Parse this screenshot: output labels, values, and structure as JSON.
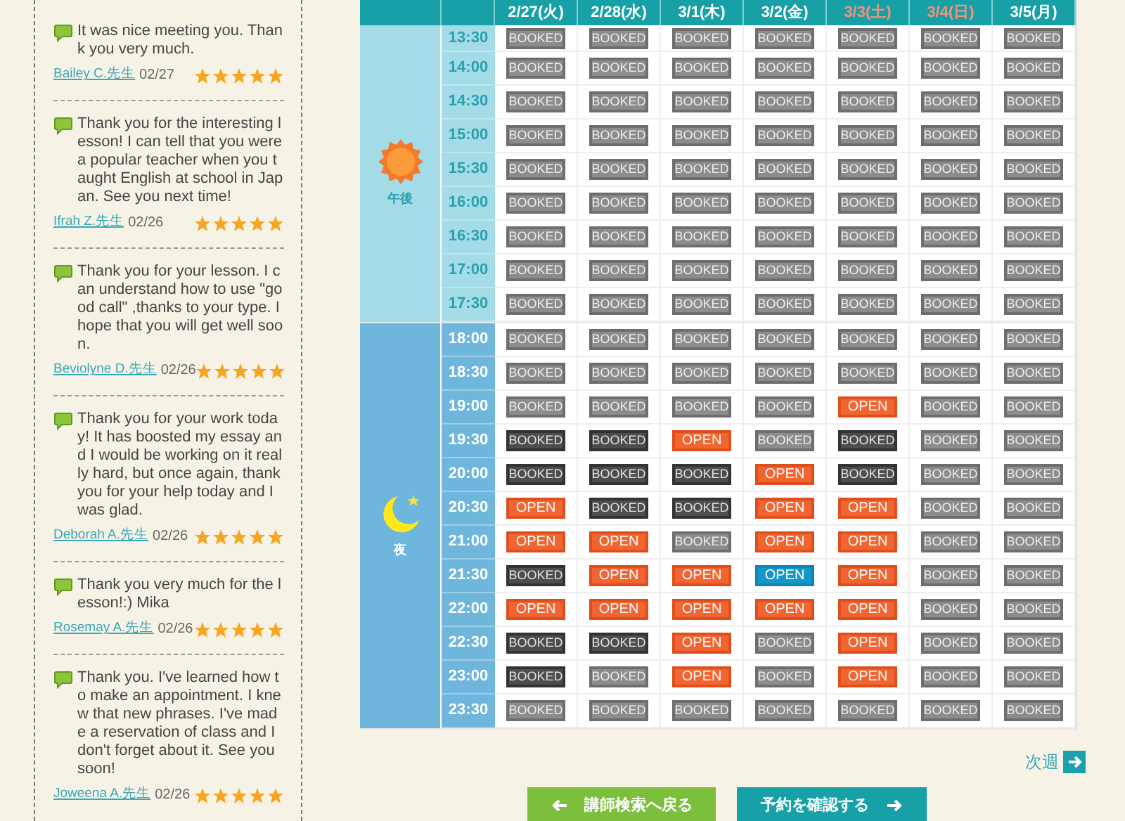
{
  "reviews": [
    {
      "text": "It was nice meeting you. Thank you very much.",
      "teacher": "Bailey C.先生",
      "date": "02/27",
      "stars": 5
    },
    {
      "text": "Thank you for the interesting lesson! I can tell that you were a popular teacher when you taught English at school in Japan. See you next time!",
      "teacher": "Ifrah Z.先生",
      "date": "02/26",
      "stars": 5
    },
    {
      "text": "Thank you for your lesson. I can understand how to use \"good call\" ,thanks to your type. I hope that you will get well soon.",
      "teacher": "Beviolyne D.先生",
      "date": "02/26",
      "stars": 5
    },
    {
      "text": "Thank you for your work today! It has boosted my essay and I would be working on it really hard, but once again, thank you for your help today and I was glad.",
      "teacher": "Deborah A.先生",
      "date": "02/26",
      "stars": 5
    },
    {
      "text": "Thank you very much for the lesson!:) Mika",
      "teacher": "Rosemay A.先生",
      "date": "02/26",
      "stars": 5
    },
    {
      "text": "Thank you. I've learned how to make an appointment. I knew that new phrases. I've made a reservation of class and I don't forget about it. See you soon!",
      "teacher": "Joweena A.先生",
      "date": "02/26",
      "stars": 5
    }
  ],
  "schedule": {
    "days": [
      {
        "label": "2/27(火)",
        "weekend": false
      },
      {
        "label": "2/28(水)",
        "weekend": false
      },
      {
        "label": "3/1(木)",
        "weekend": false
      },
      {
        "label": "3/2(金)",
        "weekend": false
      },
      {
        "label": "3/3(土)",
        "weekend": true
      },
      {
        "label": "3/4(日)",
        "weekend": true
      },
      {
        "label": "3/5(月)",
        "weekend": false
      }
    ],
    "periods": [
      {
        "kind": "afternoon",
        "label": "午後",
        "rows": [
          {
            "time": "13:30",
            "slots": [
              {
                "kind": "closed",
                "label": "BOOKED"
              },
              {
                "kind": "closed",
                "label": "BOOKED"
              },
              {
                "kind": "closed",
                "label": "BOOKED"
              },
              {
                "kind": "closed",
                "label": "BOOKED"
              },
              {
                "kind": "closed",
                "label": "BOOKED"
              },
              {
                "kind": "closed",
                "label": "BOOKED"
              },
              {
                "kind": "closed",
                "label": "BOOKED"
              }
            ]
          },
          {
            "time": "14:00",
            "slots": [
              {
                "kind": "closed",
                "label": "BOOKED"
              },
              {
                "kind": "closed",
                "label": "BOOKED"
              },
              {
                "kind": "closed",
                "label": "BOOKED"
              },
              {
                "kind": "closed",
                "label": "BOOKED"
              },
              {
                "kind": "closed",
                "label": "BOOKED"
              },
              {
                "kind": "closed",
                "label": "BOOKED"
              },
              {
                "kind": "closed",
                "label": "BOOKED"
              }
            ]
          },
          {
            "time": "14:30",
            "slots": [
              {
                "kind": "closed",
                "label": "BOOKED"
              },
              {
                "kind": "closed",
                "label": "BOOKED"
              },
              {
                "kind": "closed",
                "label": "BOOKED"
              },
              {
                "kind": "closed",
                "label": "BOOKED"
              },
              {
                "kind": "closed",
                "label": "BOOKED"
              },
              {
                "kind": "closed",
                "label": "BOOKED"
              },
              {
                "kind": "closed",
                "label": "BOOKED"
              }
            ]
          },
          {
            "time": "15:00",
            "slots": [
              {
                "kind": "closed",
                "label": "BOOKED"
              },
              {
                "kind": "closed",
                "label": "BOOKED"
              },
              {
                "kind": "closed",
                "label": "BOOKED"
              },
              {
                "kind": "closed",
                "label": "BOOKED"
              },
              {
                "kind": "closed",
                "label": "BOOKED"
              },
              {
                "kind": "closed",
                "label": "BOOKED"
              },
              {
                "kind": "closed",
                "label": "BOOKED"
              }
            ]
          },
          {
            "time": "15:30",
            "slots": [
              {
                "kind": "closed",
                "label": "BOOKED"
              },
              {
                "kind": "closed",
                "label": "BOOKED"
              },
              {
                "kind": "closed",
                "label": "BOOKED"
              },
              {
                "kind": "closed",
                "label": "BOOKED"
              },
              {
                "kind": "closed",
                "label": "BOOKED"
              },
              {
                "kind": "closed",
                "label": "BOOKED"
              },
              {
                "kind": "closed",
                "label": "BOOKED"
              }
            ]
          },
          {
            "time": "16:00",
            "slots": [
              {
                "kind": "closed",
                "label": "BOOKED"
              },
              {
                "kind": "closed",
                "label": "BOOKED"
              },
              {
                "kind": "closed",
                "label": "BOOKED"
              },
              {
                "kind": "closed",
                "label": "BOOKED"
              },
              {
                "kind": "closed",
                "label": "BOOKED"
              },
              {
                "kind": "closed",
                "label": "BOOKED"
              },
              {
                "kind": "closed",
                "label": "BOOKED"
              }
            ]
          },
          {
            "time": "16:30",
            "slots": [
              {
                "kind": "closed",
                "label": "BOOKED"
              },
              {
                "kind": "closed",
                "label": "BOOKED"
              },
              {
                "kind": "closed",
                "label": "BOOKED"
              },
              {
                "kind": "closed",
                "label": "BOOKED"
              },
              {
                "kind": "closed",
                "label": "BOOKED"
              },
              {
                "kind": "closed",
                "label": "BOOKED"
              },
              {
                "kind": "closed",
                "label": "BOOKED"
              }
            ]
          },
          {
            "time": "17:00",
            "slots": [
              {
                "kind": "closed",
                "label": "BOOKED"
              },
              {
                "kind": "closed",
                "label": "BOOKED"
              },
              {
                "kind": "closed",
                "label": "BOOKED"
              },
              {
                "kind": "closed",
                "label": "BOOKED"
              },
              {
                "kind": "closed",
                "label": "BOOKED"
              },
              {
                "kind": "closed",
                "label": "BOOKED"
              },
              {
                "kind": "closed",
                "label": "BOOKED"
              }
            ]
          },
          {
            "time": "17:30",
            "slots": [
              {
                "kind": "closed",
                "label": "BOOKED"
              },
              {
                "kind": "closed",
                "label": "BOOKED"
              },
              {
                "kind": "closed",
                "label": "BOOKED"
              },
              {
                "kind": "closed",
                "label": "BOOKED"
              },
              {
                "kind": "closed",
                "label": "BOOKED"
              },
              {
                "kind": "closed",
                "label": "BOOKED"
              },
              {
                "kind": "closed",
                "label": "BOOKED"
              }
            ]
          }
        ]
      },
      {
        "kind": "night",
        "label": "夜",
        "rows": [
          {
            "time": "18:00",
            "slots": [
              {
                "kind": "closed",
                "label": "BOOKED"
              },
              {
                "kind": "closed",
                "label": "BOOKED"
              },
              {
                "kind": "closed",
                "label": "BOOKED"
              },
              {
                "kind": "closed",
                "label": "BOOKED"
              },
              {
                "kind": "closed",
                "label": "BOOKED"
              },
              {
                "kind": "closed",
                "label": "BOOKED"
              },
              {
                "kind": "closed",
                "label": "BOOKED"
              }
            ]
          },
          {
            "time": "18:30",
            "slots": [
              {
                "kind": "closed",
                "label": "BOOKED"
              },
              {
                "kind": "closed",
                "label": "BOOKED"
              },
              {
                "kind": "closed",
                "label": "BOOKED"
              },
              {
                "kind": "closed",
                "label": "BOOKED"
              },
              {
                "kind": "closed",
                "label": "BOOKED"
              },
              {
                "kind": "closed",
                "label": "BOOKED"
              },
              {
                "kind": "closed",
                "label": "BOOKED"
              }
            ]
          },
          {
            "time": "19:00",
            "slots": [
              {
                "kind": "closed",
                "label": "BOOKED"
              },
              {
                "kind": "closed",
                "label": "BOOKED"
              },
              {
                "kind": "closed",
                "label": "BOOKED"
              },
              {
                "kind": "closed",
                "label": "BOOKED"
              },
              {
                "kind": "open",
                "label": "OPEN"
              },
              {
                "kind": "closed",
                "label": "BOOKED"
              },
              {
                "kind": "closed",
                "label": "BOOKED"
              }
            ]
          },
          {
            "time": "19:30",
            "slots": [
              {
                "kind": "booked",
                "label": "BOOKED"
              },
              {
                "kind": "booked",
                "label": "BOOKED"
              },
              {
                "kind": "open",
                "label": "OPEN"
              },
              {
                "kind": "closed",
                "label": "BOOKED"
              },
              {
                "kind": "booked",
                "label": "BOOKED"
              },
              {
                "kind": "closed",
                "label": "BOOKED"
              },
              {
                "kind": "closed",
                "label": "BOOKED"
              }
            ]
          },
          {
            "time": "20:00",
            "slots": [
              {
                "kind": "booked",
                "label": "BOOKED"
              },
              {
                "kind": "booked",
                "label": "BOOKED"
              },
              {
                "kind": "booked",
                "label": "BOOKED"
              },
              {
                "kind": "open",
                "label": "OPEN"
              },
              {
                "kind": "booked",
                "label": "BOOKED"
              },
              {
                "kind": "closed",
                "label": "BOOKED"
              },
              {
                "kind": "closed",
                "label": "BOOKED"
              }
            ]
          },
          {
            "time": "20:30",
            "slots": [
              {
                "kind": "open",
                "label": "OPEN"
              },
              {
                "kind": "booked",
                "label": "BOOKED"
              },
              {
                "kind": "booked",
                "label": "BOOKED"
              },
              {
                "kind": "open",
                "label": "OPEN"
              },
              {
                "kind": "open",
                "label": "OPEN"
              },
              {
                "kind": "closed",
                "label": "BOOKED"
              },
              {
                "kind": "closed",
                "label": "BOOKED"
              }
            ]
          },
          {
            "time": "21:00",
            "slots": [
              {
                "kind": "open",
                "label": "OPEN"
              },
              {
                "kind": "open",
                "label": "OPEN"
              },
              {
                "kind": "closed",
                "label": "BOOKED"
              },
              {
                "kind": "open",
                "label": "OPEN"
              },
              {
                "kind": "open",
                "label": "OPEN"
              },
              {
                "kind": "closed",
                "label": "BOOKED"
              },
              {
                "kind": "closed",
                "label": "BOOKED"
              }
            ]
          },
          {
            "time": "21:30",
            "slots": [
              {
                "kind": "booked",
                "label": "BOOKED"
              },
              {
                "kind": "open",
                "label": "OPEN"
              },
              {
                "kind": "open",
                "label": "OPEN"
              },
              {
                "kind": "chosen",
                "label": "OPEN"
              },
              {
                "kind": "open",
                "label": "OPEN"
              },
              {
                "kind": "closed",
                "label": "BOOKED"
              },
              {
                "kind": "closed",
                "label": "BOOKED"
              }
            ]
          },
          {
            "time": "22:00",
            "slots": [
              {
                "kind": "open",
                "label": "OPEN"
              },
              {
                "kind": "open",
                "label": "OPEN"
              },
              {
                "kind": "open",
                "label": "OPEN"
              },
              {
                "kind": "open",
                "label": "OPEN"
              },
              {
                "kind": "open",
                "label": "OPEN"
              },
              {
                "kind": "closed",
                "label": "BOOKED"
              },
              {
                "kind": "closed",
                "label": "BOOKED"
              }
            ]
          },
          {
            "time": "22:30",
            "slots": [
              {
                "kind": "booked",
                "label": "BOOKED"
              },
              {
                "kind": "booked",
                "label": "BOOKED"
              },
              {
                "kind": "open",
                "label": "OPEN"
              },
              {
                "kind": "closed",
                "label": "BOOKED"
              },
              {
                "kind": "open",
                "label": "OPEN"
              },
              {
                "kind": "closed",
                "label": "BOOKED"
              },
              {
                "kind": "closed",
                "label": "BOOKED"
              }
            ]
          },
          {
            "time": "23:00",
            "slots": [
              {
                "kind": "booked",
                "label": "BOOKED"
              },
              {
                "kind": "closed",
                "label": "BOOKED"
              },
              {
                "kind": "open",
                "label": "OPEN"
              },
              {
                "kind": "closed",
                "label": "BOOKED"
              },
              {
                "kind": "open",
                "label": "OPEN"
              },
              {
                "kind": "closed",
                "label": "BOOKED"
              },
              {
                "kind": "closed",
                "label": "BOOKED"
              }
            ]
          },
          {
            "time": "23:30",
            "slots": [
              {
                "kind": "closed",
                "label": "BOOKED"
              },
              {
                "kind": "closed",
                "label": "BOOKED"
              },
              {
                "kind": "closed",
                "label": "BOOKED"
              },
              {
                "kind": "closed",
                "label": "BOOKED"
              },
              {
                "kind": "closed",
                "label": "BOOKED"
              },
              {
                "kind": "closed",
                "label": "BOOKED"
              },
              {
                "kind": "closed",
                "label": "BOOKED"
              }
            ]
          }
        ]
      }
    ]
  },
  "next_week": {
    "label": "次週"
  },
  "back_button": {
    "label": "講師検索へ戻る"
  },
  "confirm_button": {
    "label": "予約を確認する"
  }
}
